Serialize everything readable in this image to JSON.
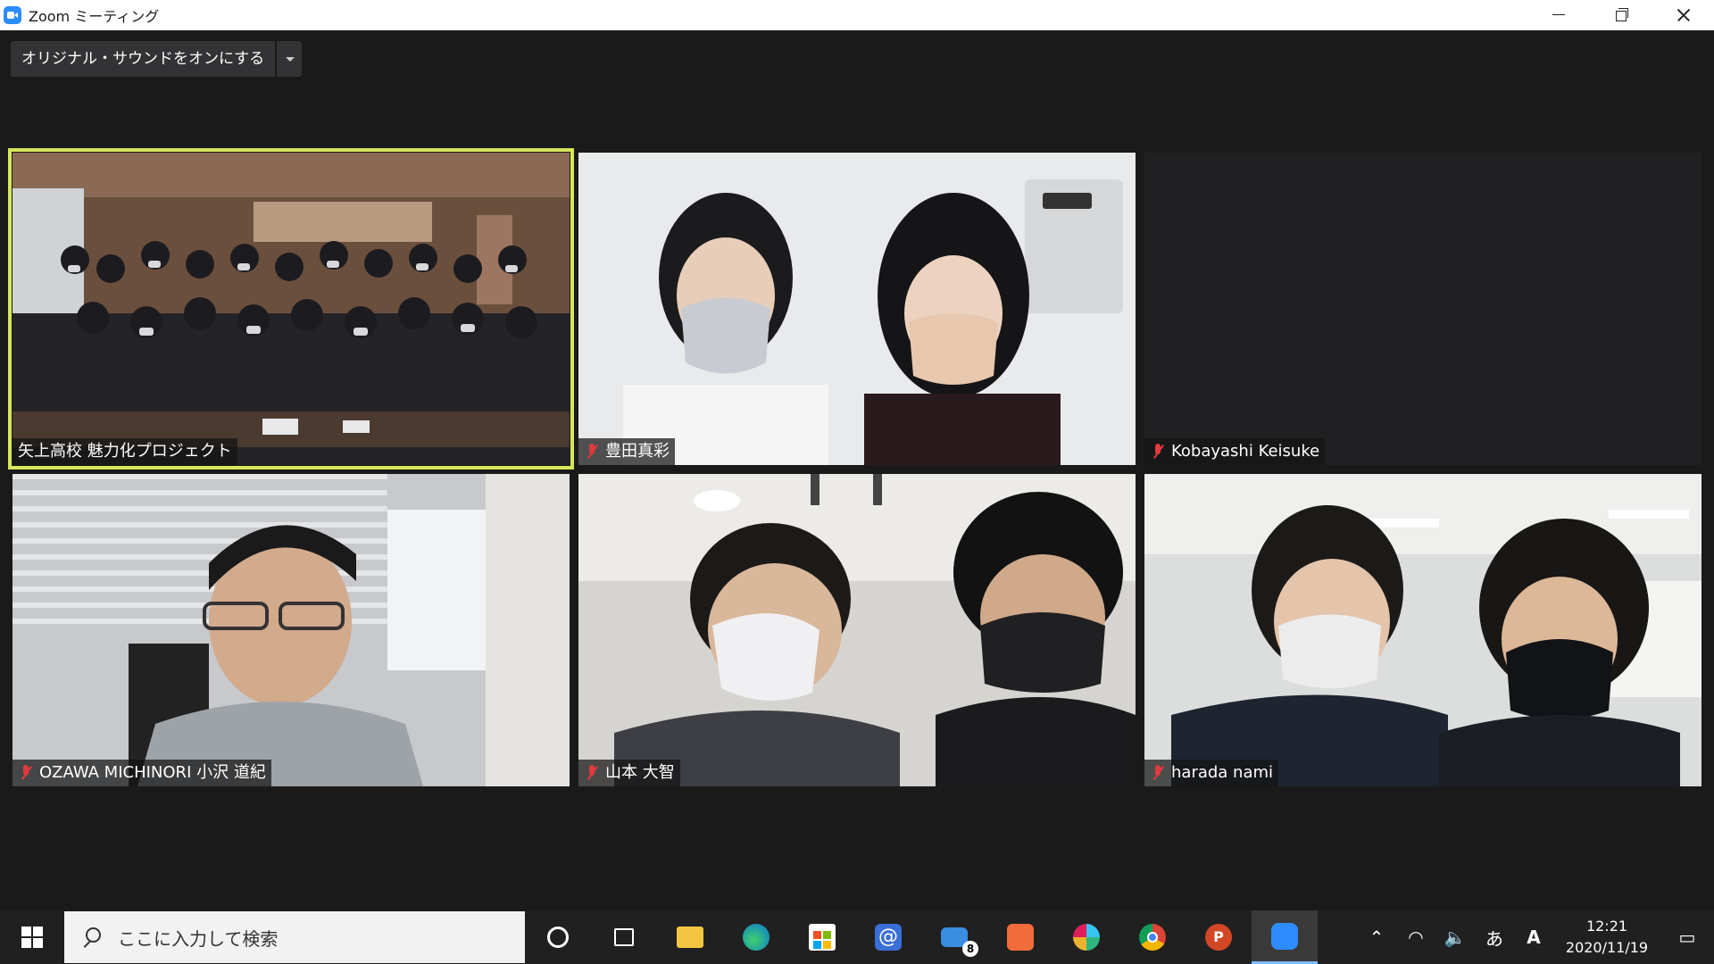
{
  "window": {
    "title": "Zoom ミーティング"
  },
  "toolbar": {
    "original_sound_label": "オリジナル・サウンドをオンにする"
  },
  "participants": [
    {
      "name": "矢上高校 魅力化プロジェクト",
      "muted": false,
      "active_speaker": true
    },
    {
      "name": "豊田真彩",
      "muted": true,
      "active_speaker": false
    },
    {
      "name": "Kobayashi Keisuke",
      "muted": true,
      "active_speaker": false
    },
    {
      "name": "OZAWA MICHINORI 小沢 道紀",
      "muted": true,
      "active_speaker": false
    },
    {
      "name": "山本 大智",
      "muted": true,
      "active_speaker": false
    },
    {
      "name": "harada nami",
      "muted": true,
      "active_speaker": false
    }
  ],
  "taskbar": {
    "search_placeholder": "ここに入力して検索",
    "mail_badge": "8",
    "ime_indicator": "あ",
    "time": "12:21",
    "date": "2020/11/19"
  },
  "colors": {
    "active_speaker_border": "#d8e65a",
    "muted_icon": "#e03a3e",
    "zoom_blue": "#2d8cff"
  }
}
